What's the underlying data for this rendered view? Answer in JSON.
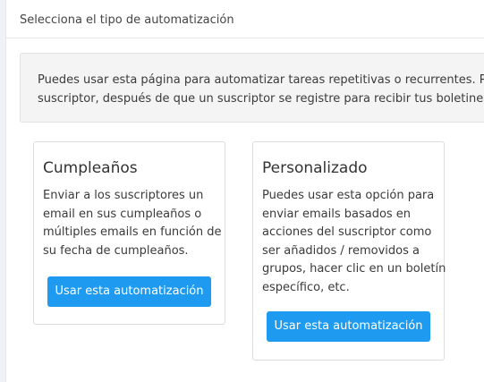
{
  "header": {
    "title": "Selecciona el tipo de automatización"
  },
  "info": {
    "lines": [
      "Puedes usar esta página para automatizar tareas repetitivas o recurrentes. Puede",
      "suscriptor, después de que un suscriptor se registre para recibir tus boletines, etc"
    ]
  },
  "cards": [
    {
      "title": "Cumpleaños",
      "description_lines": [
        "Enviar a los suscriptores un",
        "email en sus cumpleaños o",
        "múltiples emails en función de",
        "su fecha de cumpleaños."
      ],
      "button_label": "Usar esta automatización"
    },
    {
      "title": "Personalizado",
      "description_lines": [
        "Puedes usar esta opción para",
        "enviar emails basados en",
        "acciones del suscriptor como",
        "ser añadidos / removidos a",
        "grupos, hacer clic en un boletín",
        "específico, etc."
      ],
      "button_label": "Usar esta automatización"
    }
  ],
  "colors": {
    "button": "#1e9bf0",
    "info_background": "#f4f4f4",
    "card_border": "#dcdcdc"
  }
}
